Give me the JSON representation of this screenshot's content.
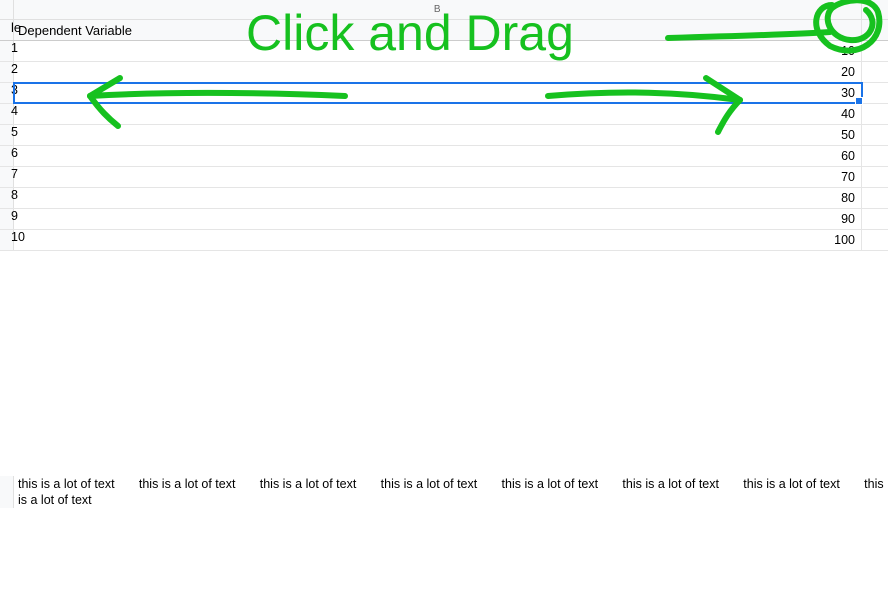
{
  "columns": {
    "b_label": "B"
  },
  "header": {
    "a_trail": "le",
    "b": "Dependent Variable"
  },
  "rows": [
    {
      "a": "1",
      "b": "10"
    },
    {
      "a": "2",
      "b": "20"
    },
    {
      "a": "3",
      "b": "30"
    },
    {
      "a": "4",
      "b": "40"
    },
    {
      "a": "5",
      "b": "50"
    },
    {
      "a": "6",
      "b": "60"
    },
    {
      "a": "7",
      "b": "70"
    },
    {
      "a": "8",
      "b": "80"
    },
    {
      "a": "9",
      "b": "90"
    },
    {
      "a": "10",
      "b": "100"
    }
  ],
  "selected_row_index": 2,
  "longtext": "this is a lot of text       this is a lot of text       this is a lot of text       this is a lot of text       this is a lot of text       this is a lot of text       this is a lot of text       this is a lot of text",
  "annotation": {
    "text": "Click and Drag",
    "color": "#16c11f"
  }
}
